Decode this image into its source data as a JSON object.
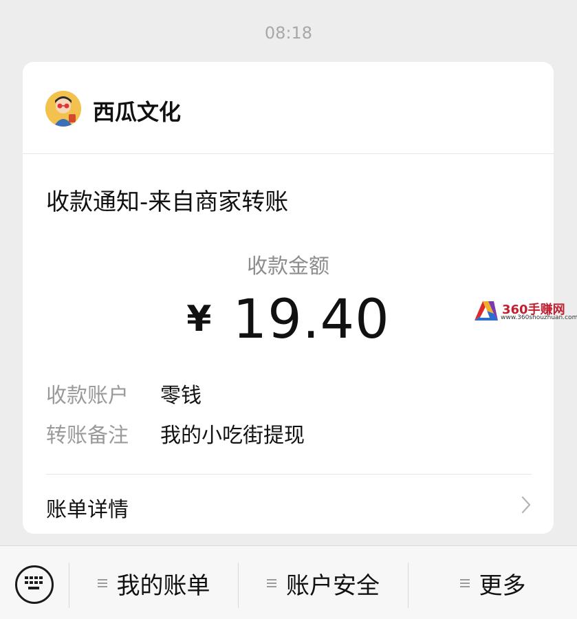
{
  "chat": {
    "timestamp": "08:18"
  },
  "card": {
    "merchant_name": "西瓜文化",
    "notice_title": "收款通知-来自商家转账",
    "amount_label": "收款金额",
    "currency_symbol": "¥",
    "amount_value": "19.40",
    "rows": [
      {
        "label": "收款账户",
        "value": "零钱"
      },
      {
        "label": "转账备注",
        "value": "我的小吃街提现"
      }
    ],
    "details_label": "账单详情"
  },
  "watermark": {
    "title": "360手赚网",
    "subtitle": "www.360shouzhuan.com"
  },
  "bottom_menu": {
    "items": [
      {
        "label": "我的账单",
        "icon": "menu-lines-icon"
      },
      {
        "label": "账户安全",
        "icon": "menu-lines-icon"
      },
      {
        "label": "更多",
        "icon": "menu-lines-icon"
      }
    ],
    "keyboard_icon": "keyboard-icon"
  },
  "colors": {
    "background": "#ededed",
    "card": "#ffffff",
    "muted_text": "#9a9a9a",
    "primary_text": "#111111",
    "watermark_red": "#c02030"
  }
}
